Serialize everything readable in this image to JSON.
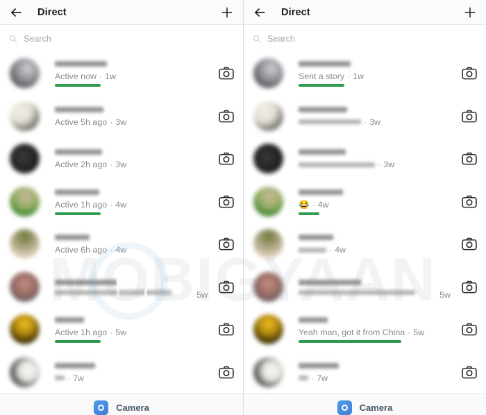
{
  "meta": {
    "watermark": "MOBIGYAAN",
    "accent_green": "#2e9b4f",
    "camera_blue": "#4285cf"
  },
  "header": {
    "title": "Direct",
    "back_icon": "arrow-left-icon",
    "new_message_icon": "plus-icon"
  },
  "search": {
    "placeholder": "Search",
    "icon": "search-icon"
  },
  "footer": {
    "label": "Camera",
    "icon": "camera-icon"
  },
  "panels": [
    {
      "id": "left",
      "rows": [
        {
          "sub": "Active now",
          "time": "1w",
          "highlight": true,
          "highlight_width": 66,
          "uname_width": 75,
          "avatar": "grey-dark",
          "blur_sub": false,
          "time_inline": true
        },
        {
          "sub": "Active 5h ago",
          "time": "3w",
          "highlight": false,
          "highlight_width": 0,
          "uname_width": 70,
          "avatar": "cream-black",
          "blur_sub": false,
          "time_inline": true
        },
        {
          "sub": "Active 2h ago",
          "time": "3w",
          "highlight": false,
          "highlight_width": 0,
          "uname_width": 68,
          "avatar": "black-a",
          "blur_sub": false,
          "time_inline": true
        },
        {
          "sub": "Active 1h ago",
          "time": "4w",
          "highlight": true,
          "highlight_width": 66,
          "uname_width": 64,
          "avatar": "green-field",
          "blur_sub": false,
          "time_inline": true
        },
        {
          "sub": "Active 6h ago",
          "time": "4w",
          "highlight": false,
          "highlight_width": 0,
          "uname_width": 50,
          "avatar": "olive-tan",
          "blur_sub": false,
          "time_inline": true
        },
        {
          "sub": "",
          "time": "5w",
          "highlight": false,
          "highlight_width": 0,
          "uname_width": 90,
          "avatar": "pink-brown",
          "blur_sub": true,
          "blur_sub_width": 168,
          "time_inline": false
        },
        {
          "sub": "Active 1h ago",
          "time": "5w",
          "highlight": true,
          "highlight_width": 66,
          "uname_width": 42,
          "avatar": "gold-black",
          "blur_sub": false,
          "time_inline": true
        },
        {
          "sub": "",
          "time": "7w",
          "highlight": false,
          "highlight_width": 0,
          "uname_width": 58,
          "avatar": "white-black",
          "blur_sub": true,
          "blur_sub_width": 14,
          "time_inline": true
        }
      ]
    },
    {
      "id": "right",
      "rows": [
        {
          "sub": "Sent a story",
          "time": "1w",
          "highlight": true,
          "highlight_width": 66,
          "uname_width": 75,
          "avatar": "grey-dark",
          "blur_sub": false,
          "time_inline": true
        },
        {
          "sub": "",
          "time": "3w",
          "highlight": false,
          "highlight_width": 0,
          "uname_width": 70,
          "avatar": "cream-black",
          "blur_sub": true,
          "blur_sub_width": 90,
          "time_inline": true
        },
        {
          "sub": "",
          "time": "3w",
          "highlight": false,
          "highlight_width": 0,
          "uname_width": 68,
          "avatar": "black-a",
          "blur_sub": true,
          "blur_sub_width": 110,
          "time_inline": true
        },
        {
          "sub": "emoji",
          "emoji": "😂",
          "time": "4w",
          "highlight": true,
          "highlight_width": 30,
          "uname_width": 64,
          "avatar": "green-field",
          "blur_sub": false,
          "time_inline": true
        },
        {
          "sub": "",
          "time": "4w",
          "highlight": false,
          "highlight_width": 0,
          "uname_width": 50,
          "avatar": "olive-tan",
          "blur_sub": true,
          "blur_sub_width": 40,
          "time_inline": true
        },
        {
          "sub": "",
          "time": "5w",
          "highlight": false,
          "highlight_width": 0,
          "uname_width": 90,
          "avatar": "pink-brown",
          "blur_sub": true,
          "blur_sub_width": 168,
          "time_inline": false
        },
        {
          "sub": "Yeah man, got it from China",
          "time": "5w",
          "highlight": true,
          "highlight_width": 148,
          "uname_width": 42,
          "avatar": "gold-black",
          "blur_sub": false,
          "time_inline": true
        },
        {
          "sub": "",
          "time": "7w",
          "highlight": false,
          "highlight_width": 0,
          "uname_width": 58,
          "avatar": "white-black",
          "blur_sub": true,
          "blur_sub_width": 14,
          "time_inline": true
        }
      ]
    }
  ]
}
